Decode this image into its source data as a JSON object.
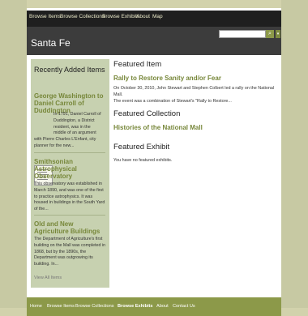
{
  "top_nav": [
    "Browse Items",
    "Browse Collections",
    "Browse Exhibits",
    "About",
    "Map"
  ],
  "header": {
    "site_title": "Santa Fe",
    "search_placeholder": "",
    "search_button": "⌕",
    "more_button": "▾"
  },
  "sidebar": {
    "title": "Recently Added Items",
    "items": [
      {
        "title_lines": [
          "George Washington to",
          "Daniel Carroll of",
          "Duddington"
        ],
        "text_lines": [
          "In 1791, Daniel Carroll of",
          "Duddington, a District",
          "resident, was in the",
          "middle of an argument",
          "with Pierre Charles L'Enfant, city",
          "planner for the new..."
        ]
      },
      {
        "title_lines": [
          "Smithsonian",
          "Astrophysical",
          "Observatory"
        ],
        "text_lines": [
          "This observatory was established in",
          "March 1890, and was one of the first",
          "to practice astrophysics. It was",
          "housed in buildings in the South Yard",
          "of the..."
        ]
      },
      {
        "title_lines": [
          "Old and New",
          "Agriculture Buildings"
        ],
        "text_lines": [
          "The Department of Agriculture's first",
          "building on the Mall was completed in",
          "1868, but by the 1890s, the",
          "Department was outgrowing its",
          "building. In..."
        ]
      }
    ],
    "view_all": "View All Items"
  },
  "main": {
    "featured_item": {
      "heading": "Featured Item",
      "title": "Rally to Restore Sanity and/or Fear",
      "text_lines": [
        "On October 30, 2010, John Stewart and Stephen Colbert led a rally on the National Mall.",
        "The event was a combination of Stewart's \"Rally to Restore..."
      ]
    },
    "featured_collection": {
      "heading": "Featured Collection",
      "title": "Histories of the National Mall"
    },
    "featured_exhibit": {
      "heading": "Featured Exhibit",
      "text": "You have no featured exhibits."
    }
  },
  "footer": [
    "Home",
    "Browse Items",
    "Browse Collections",
    "Browse Exhibits",
    "About",
    "Contact Us"
  ],
  "colors": {
    "accent": "#77873a",
    "footer_bg": "#8c9949",
    "sidebar_bg": "#c7d1b0",
    "header_bg": "#3c3c3c",
    "nav_bg": "#1f1f1f"
  }
}
